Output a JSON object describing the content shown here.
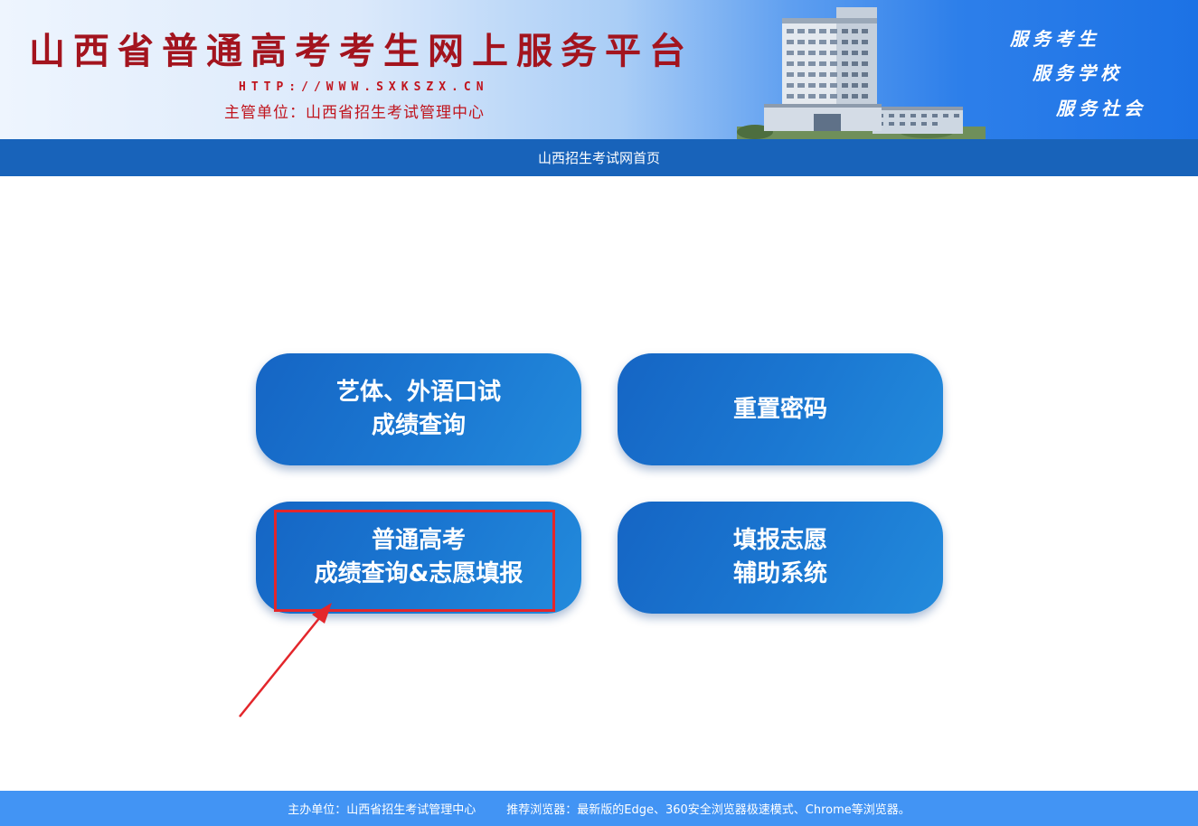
{
  "banner": {
    "title": "山西省普通高考考生网上服务平台",
    "url": "HTTP://WWW.SXKSZX.CN",
    "org": "主管单位：山西省招生考试管理中心",
    "slogans": [
      "服务考生",
      "服务学校",
      "服务社会"
    ]
  },
  "nav": {
    "home_link": "山西招生考试网首页"
  },
  "tiles": [
    {
      "label": "艺体、外语口试\n成绩查询"
    },
    {
      "label": "重置密码"
    },
    {
      "label": "普通高考\n成绩查询&志愿填报"
    },
    {
      "label": "填报志愿\n辅助系统"
    }
  ],
  "footer": {
    "host": "主办单位：山西省招生考试管理中心",
    "browser_tip": "推荐浏览器：最新版的Edge、360安全浏览器极速模式、Chrome等浏览器。"
  },
  "colors": {
    "title_red": "#a3141e",
    "nav_blue": "#1863ba",
    "tile_blue": "#1b78d2",
    "footer_blue": "#4294f4",
    "highlight_red": "#e3262b"
  }
}
